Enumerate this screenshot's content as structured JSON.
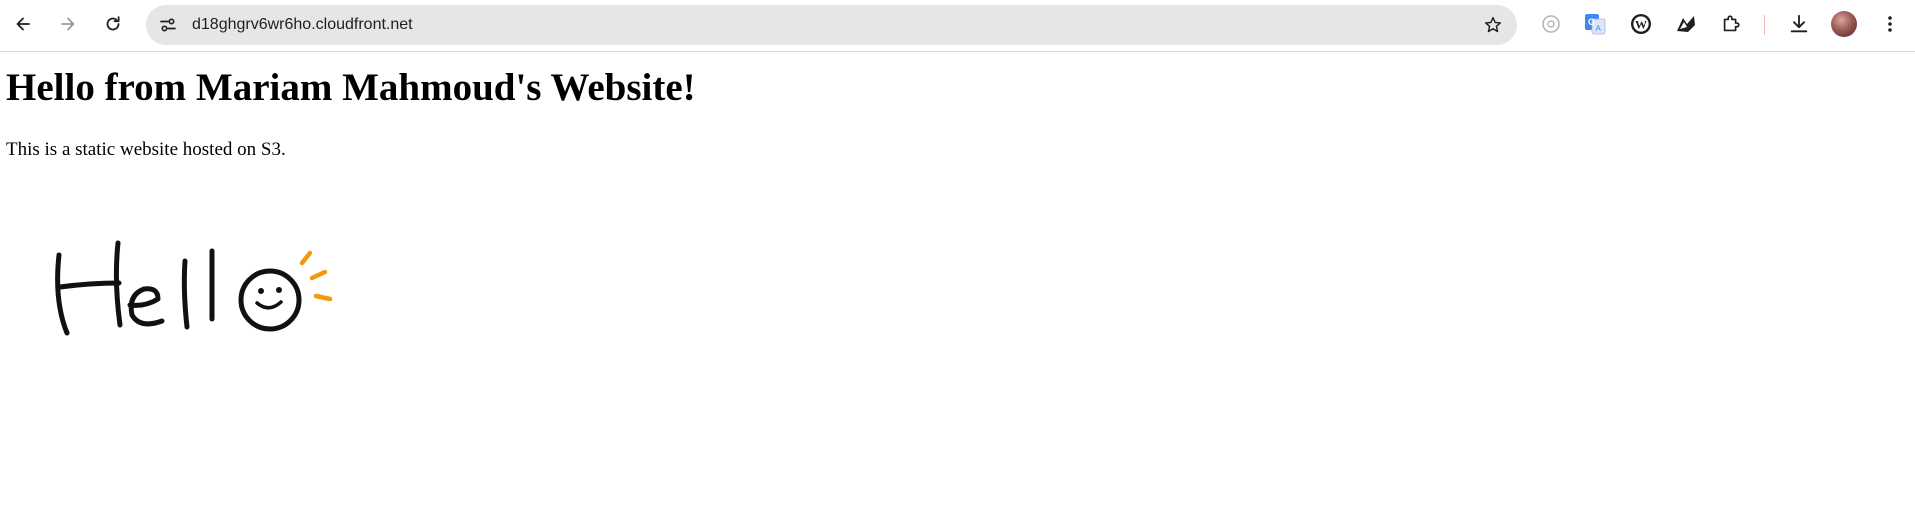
{
  "browser": {
    "address_bar": {
      "url": "d18ghgrv6wr6ho.cloudfront.net"
    },
    "icons": [
      "back-arrow-icon",
      "forward-arrow-icon",
      "reload-icon",
      "site-info-icon",
      "bookmark-star-icon",
      "lens-icon",
      "google-translate-icon",
      "wordpress-icon",
      "extension-icon",
      "puzzle-extensions-icon",
      "download-icon",
      "profile-avatar",
      "more-menu-icon"
    ]
  },
  "page": {
    "heading": "Hello from Mariam Mahmoud's Website!",
    "paragraph": "This is a static website hosted on S3.",
    "image": {
      "lettering": "Hello",
      "accent_color": "#f29a0c"
    }
  }
}
